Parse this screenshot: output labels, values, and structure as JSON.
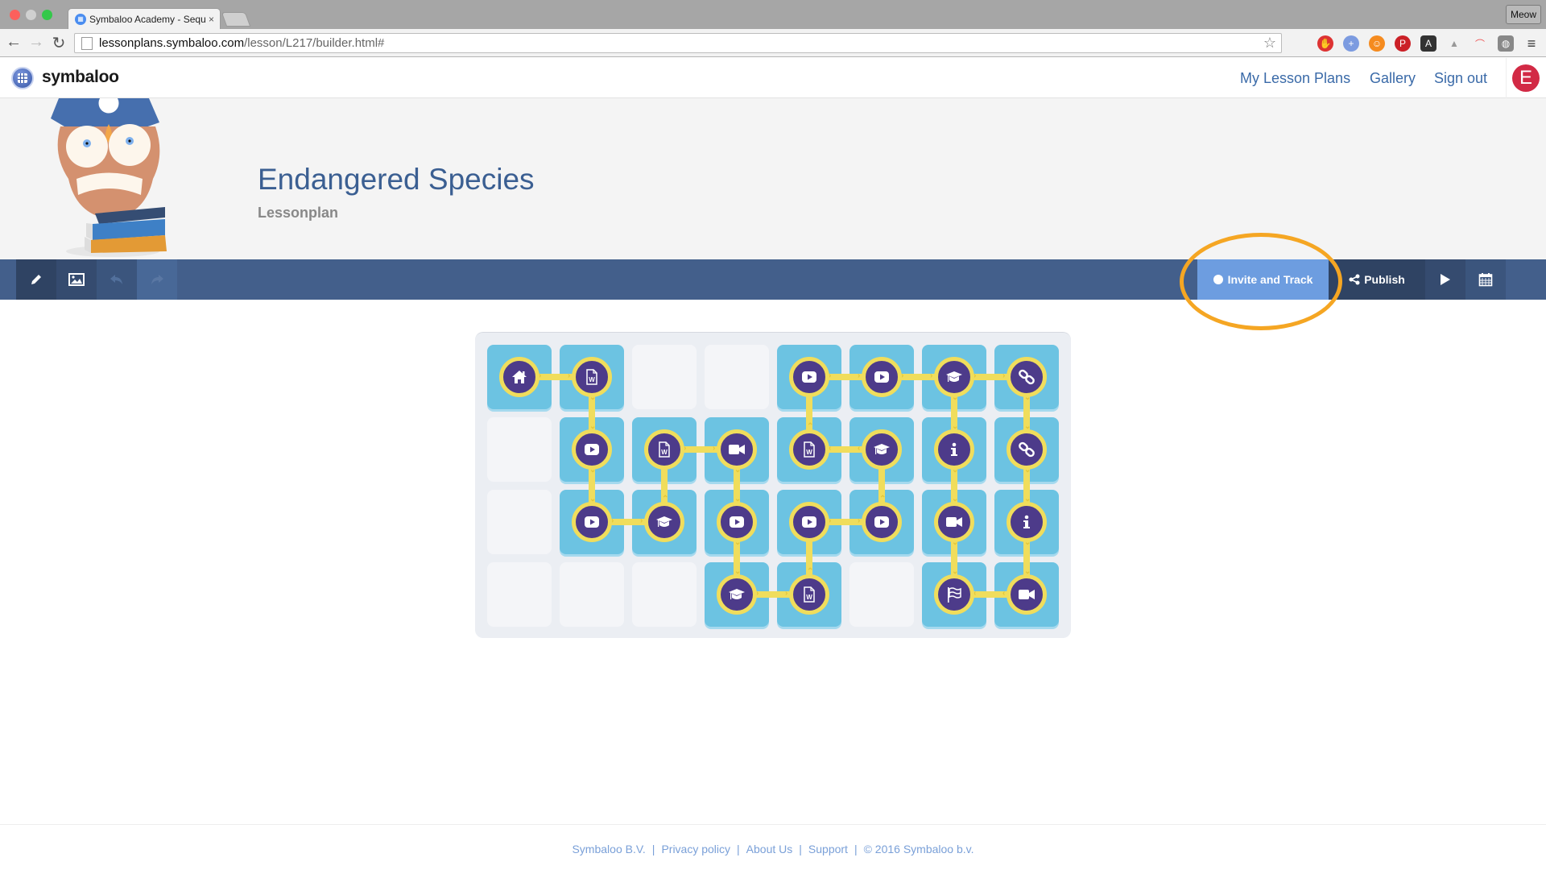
{
  "browser": {
    "tab_title": "Symbaloo Academy - Sequ",
    "tab_close": "×",
    "url_host": "lessonplans.symbaloo.com",
    "url_path": "/lesson/L217/builder.html#",
    "profile_button": "Meow",
    "star_icon": "☆",
    "menu_icon": "≡"
  },
  "app": {
    "logo_text": "symbaloo",
    "nav": [
      "My Lesson Plans",
      "Gallery",
      "Sign out"
    ],
    "avatar_letter": "E"
  },
  "lesson": {
    "title": "Endangered Species",
    "subtitle": "Lessonplan"
  },
  "toolbar": {
    "left_icons": [
      "pencil-icon",
      "image-icon",
      "undo-icon",
      "redo-icon"
    ],
    "invite_label": "Invite and Track",
    "publish_label": "Publish",
    "play_icon": "play-icon",
    "calendar_icon": "calendar-icon"
  },
  "grid": {
    "rows": 4,
    "cols": 8,
    "tiles": [
      [
        "home",
        "word",
        null,
        null,
        "video",
        "video",
        "cap",
        "link"
      ],
      [
        null,
        "video",
        "word",
        "camera",
        "word",
        "cap",
        "info",
        "link"
      ],
      [
        null,
        "video",
        "cap",
        "video",
        "video",
        "video",
        "camera",
        "info"
      ],
      [
        null,
        null,
        null,
        "cap",
        "word",
        null,
        "flag",
        "camera"
      ]
    ],
    "connections": [
      [
        [
          0,
          0
        ],
        [
          0,
          1
        ],
        ">"
      ],
      [
        [
          0,
          1
        ],
        [
          1,
          1
        ],
        "v"
      ],
      [
        [
          1,
          1
        ],
        [
          2,
          1
        ],
        "v"
      ],
      [
        [
          2,
          1
        ],
        [
          2,
          2
        ],
        ">"
      ],
      [
        [
          2,
          2
        ],
        [
          1,
          2
        ],
        "^"
      ],
      [
        [
          1,
          2
        ],
        [
          1,
          3
        ],
        ">"
      ],
      [
        [
          1,
          3
        ],
        [
          2,
          3
        ],
        "v"
      ],
      [
        [
          2,
          3
        ],
        [
          3,
          3
        ],
        "v"
      ],
      [
        [
          3,
          3
        ],
        [
          3,
          4
        ],
        ">"
      ],
      [
        [
          3,
          4
        ],
        [
          2,
          4
        ],
        "^"
      ],
      [
        [
          2,
          4
        ],
        [
          2,
          5
        ],
        ">"
      ],
      [
        [
          2,
          5
        ],
        [
          1,
          5
        ],
        "^"
      ],
      [
        [
          1,
          5
        ],
        [
          1,
          4
        ],
        "<"
      ],
      [
        [
          1,
          4
        ],
        [
          0,
          4
        ],
        "^"
      ],
      [
        [
          0,
          4
        ],
        [
          0,
          5
        ],
        ">"
      ],
      [
        [
          0,
          5
        ],
        [
          0,
          6
        ],
        ">"
      ],
      [
        [
          0,
          6
        ],
        [
          0,
          7
        ],
        ">"
      ],
      [
        [
          0,
          6
        ],
        [
          1,
          6
        ],
        "v"
      ],
      [
        [
          1,
          6
        ],
        [
          2,
          6
        ],
        "v"
      ],
      [
        [
          2,
          6
        ],
        [
          3,
          6
        ],
        "v"
      ],
      [
        [
          0,
          7
        ],
        [
          1,
          7
        ],
        "v"
      ],
      [
        [
          1,
          7
        ],
        [
          2,
          7
        ],
        "v"
      ],
      [
        [
          2,
          7
        ],
        [
          3,
          7
        ],
        "v"
      ],
      [
        [
          3,
          7
        ],
        [
          3,
          6
        ],
        "<"
      ]
    ]
  },
  "footer": {
    "links": [
      "Symbaloo B.V.",
      "Privacy policy",
      "About Us",
      "Support",
      "© 2016 Symbaloo b.v."
    ],
    "separator": "|"
  }
}
